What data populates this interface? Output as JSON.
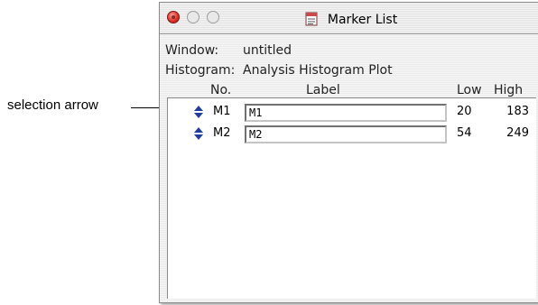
{
  "callout": {
    "label": "selection arrow"
  },
  "window": {
    "title": "Marker List",
    "title_icon": "marker-list-icon",
    "controls": [
      "close-button",
      "minimize-button",
      "zoom-button"
    ]
  },
  "info": {
    "window_label": "Window:",
    "window_value": "untitled",
    "histogram_label": "Histogram:",
    "histogram_value": "Analysis Histogram Plot"
  },
  "table": {
    "columns": {
      "no": "No.",
      "label": "Label",
      "low": "Low",
      "high": "High"
    },
    "rows": [
      {
        "no": "M1",
        "label": "M1",
        "low": "20",
        "high": "183",
        "icon": "selection-arrow-icon"
      },
      {
        "no": "M2",
        "label": "M2",
        "low": "54",
        "high": "249",
        "icon": "selection-arrow-icon"
      }
    ]
  },
  "colors": {
    "close_button": "#e0342c",
    "arrow": "#1f3f9e"
  }
}
